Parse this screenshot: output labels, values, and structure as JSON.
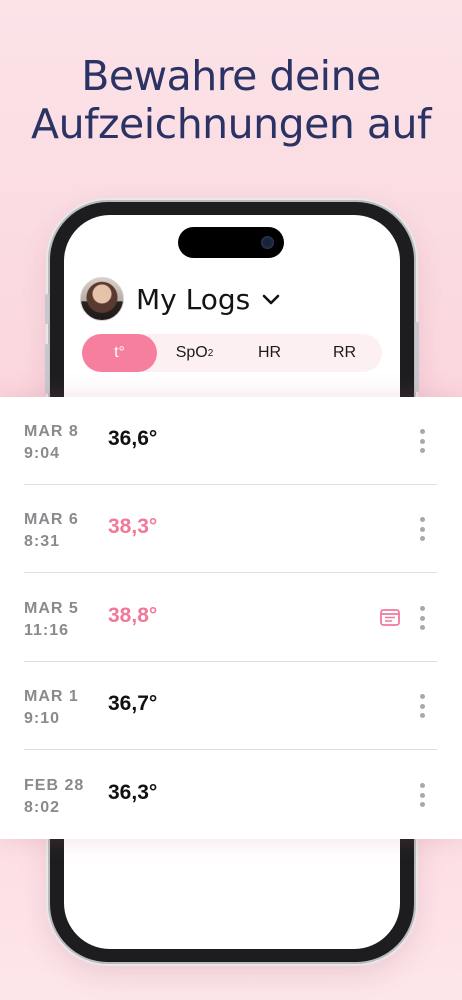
{
  "headline": {
    "line1": "Bewahre deine",
    "line2": "Aufzeichnungen auf"
  },
  "app": {
    "title": "My Logs",
    "tabs": [
      {
        "label": "t°",
        "active": true
      },
      {
        "label": "SpO",
        "sub": "2",
        "active": false
      },
      {
        "label": "HR",
        "active": false
      },
      {
        "label": "RR",
        "active": false
      }
    ]
  },
  "logs": [
    {
      "date": "MAR 8",
      "time": "9:04",
      "value": "36,6°",
      "fever": false,
      "has_note": false
    },
    {
      "date": "MAR 6",
      "time": "8:31",
      "value": "38,3°",
      "fever": true,
      "has_note": false
    },
    {
      "date": "MAR 5",
      "time": "11:16",
      "value": "38,8°",
      "fever": true,
      "has_note": true
    },
    {
      "date": "MAR 1",
      "time": "9:10",
      "value": "36,7°",
      "fever": false,
      "has_note": false
    },
    {
      "date": "FEB 28",
      "time": "8:02",
      "value": "36,3°",
      "fever": false,
      "has_note": false
    }
  ],
  "colors": {
    "accent": "#f67f9d",
    "fever_text": "#f2789a",
    "headline": "#2b3264"
  },
  "icons": {
    "more": "kebab-menu-icon",
    "note": "note-icon",
    "dropdown": "chevron-down-icon"
  }
}
